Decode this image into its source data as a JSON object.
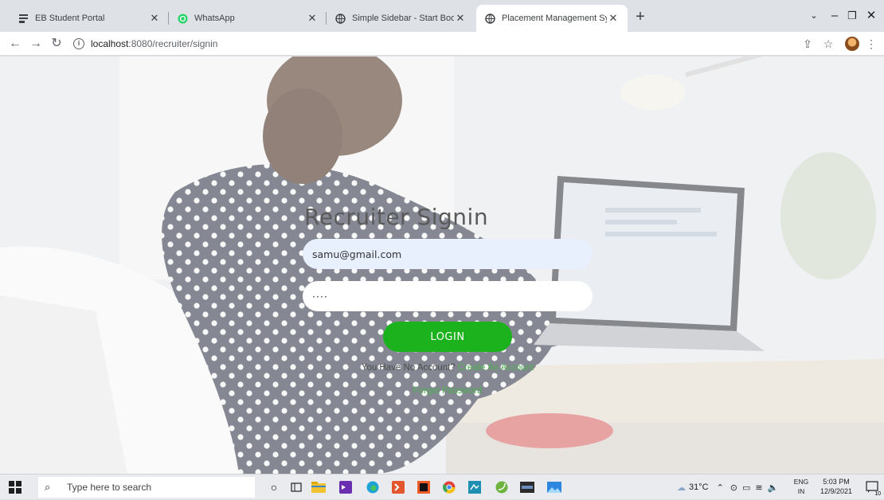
{
  "tabs": [
    {
      "label": "EB Student Portal",
      "icon": "portal-icon"
    },
    {
      "label": "WhatsApp",
      "icon": "whatsapp-icon"
    },
    {
      "label": "Simple Sidebar - Start Bootstrap",
      "icon": "globe-icon"
    },
    {
      "label": "Placement Management System",
      "icon": "globe-icon",
      "active": true
    }
  ],
  "address_bar": {
    "url_host": "localhost",
    "url_path": ":8080/recruiter/signin"
  },
  "signin": {
    "title": "Recruiter Signin",
    "email_value": "samu@gmail.com",
    "password_value": "····",
    "login_label": "LOGIN",
    "no_account_text": "You Have No Account?",
    "create_account_link": "Create An Account",
    "forget_password_link": "Forget Password"
  },
  "taskbar": {
    "search_placeholder": "Type here to search",
    "weather": "31°C",
    "lang_line1": "ENG",
    "lang_line2": "IN",
    "time": "5:03 PM",
    "date": "12/9/2021",
    "notification_count": "10"
  },
  "colors": {
    "login_button": "#1bb21d",
    "link_green": "#4caf50",
    "email_autofill_bg": "#e8f0fe"
  }
}
